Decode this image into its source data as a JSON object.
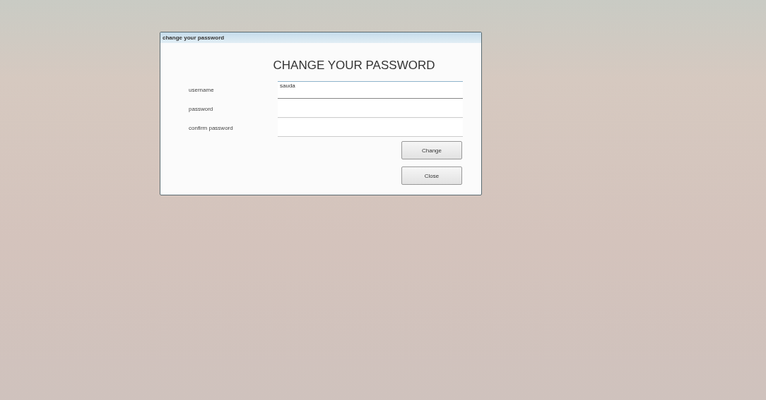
{
  "window": {
    "title": "change your password"
  },
  "heading": "CHANGE YOUR PASSWORD",
  "fields": [
    {
      "label": "username",
      "value": "sauda",
      "focused": true
    },
    {
      "label": "password",
      "focused": false
    },
    {
      "label": "confirm password",
      "focused": false
    }
  ],
  "buttons": [
    "Change",
    "Close"
  ]
}
